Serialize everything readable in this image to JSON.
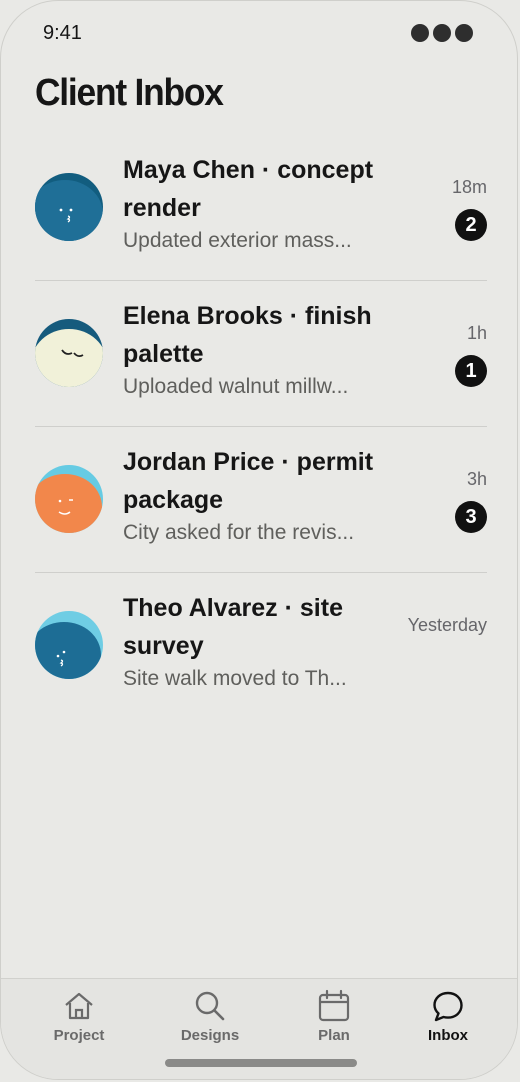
{
  "status": {
    "time": "9:41"
  },
  "title": "Client Inbox",
  "threads": [
    {
      "name": "Maya Chen · concept render",
      "preview": "Updated exterior mass...",
      "time": "18m",
      "unread": "2",
      "avatar_color": "#1f6f97",
      "avatar_bg": "#125d7f"
    },
    {
      "name": "Elena Brooks · finish palette",
      "preview": "Uploaded walnut millw...",
      "time": "1h",
      "unread": "1",
      "avatar_color": "#f1f1d9",
      "avatar_bg": "#165b7d"
    },
    {
      "name": "Jordan Price · permit package",
      "preview": "City asked for the revis...",
      "time": "3h",
      "unread": "3",
      "avatar_color": "#f2874b",
      "avatar_bg": "#66cbe3"
    },
    {
      "name": "Theo Alvarez · site survey",
      "preview": "Site walk moved to Th...",
      "time": "Yesterday",
      "unread": "",
      "avatar_color": "#1d6d95",
      "avatar_bg": "#6fcde4"
    }
  ],
  "tabs": [
    {
      "label": "Project",
      "icon": "home-icon",
      "active": false
    },
    {
      "label": "Designs",
      "icon": "search-icon",
      "active": false
    },
    {
      "label": "Plan",
      "icon": "calendar-icon",
      "active": false
    },
    {
      "label": "Inbox",
      "icon": "chat-bubble-icon",
      "active": true
    }
  ]
}
